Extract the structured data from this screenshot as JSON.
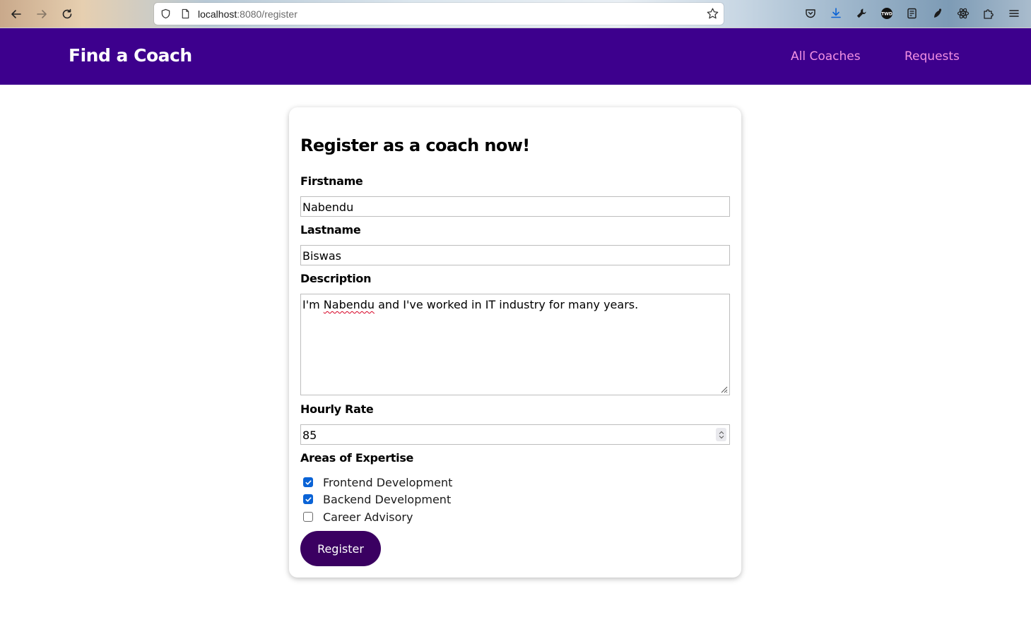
{
  "browser": {
    "url_host": "localhost",
    "url_rest": ":8080/register"
  },
  "header": {
    "brand": "Find a Coach",
    "nav": [
      "All Coaches",
      "Requests"
    ]
  },
  "form": {
    "title": "Register as a coach now!",
    "firstname": {
      "label": "Firstname",
      "value": "Nabendu"
    },
    "lastname": {
      "label": "Lastname",
      "value": "Biswas"
    },
    "description": {
      "label": "Description",
      "value_pre": "I'm ",
      "value_misspelled": "Nabendu",
      "value_post": " and I've worked in IT industry for many years."
    },
    "rate": {
      "label": "Hourly Rate",
      "value": "85"
    },
    "areas": {
      "label": "Areas of Expertise",
      "options": [
        {
          "label": "Frontend Development",
          "checked": true
        },
        {
          "label": "Backend Development",
          "checked": true
        },
        {
          "label": "Career Advisory",
          "checked": false
        }
      ]
    },
    "submit_label": "Register"
  },
  "colors": {
    "header_bg": "#3d008d",
    "nav_link": "#f391e3",
    "button_bg": "#3a0061",
    "checkbox": "#0a63d6"
  }
}
